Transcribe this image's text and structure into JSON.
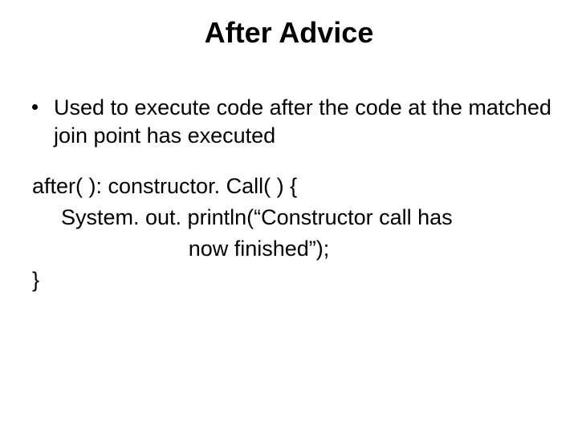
{
  "title": "After Advice",
  "bullet": "Used to execute code after the code at the matched join point has executed",
  "code": {
    "line1": "after( ): constructor. Call( ) {",
    "line2": "System. out. println(“Constructor call has",
    "line3": "now finished”);",
    "line4": "}"
  }
}
